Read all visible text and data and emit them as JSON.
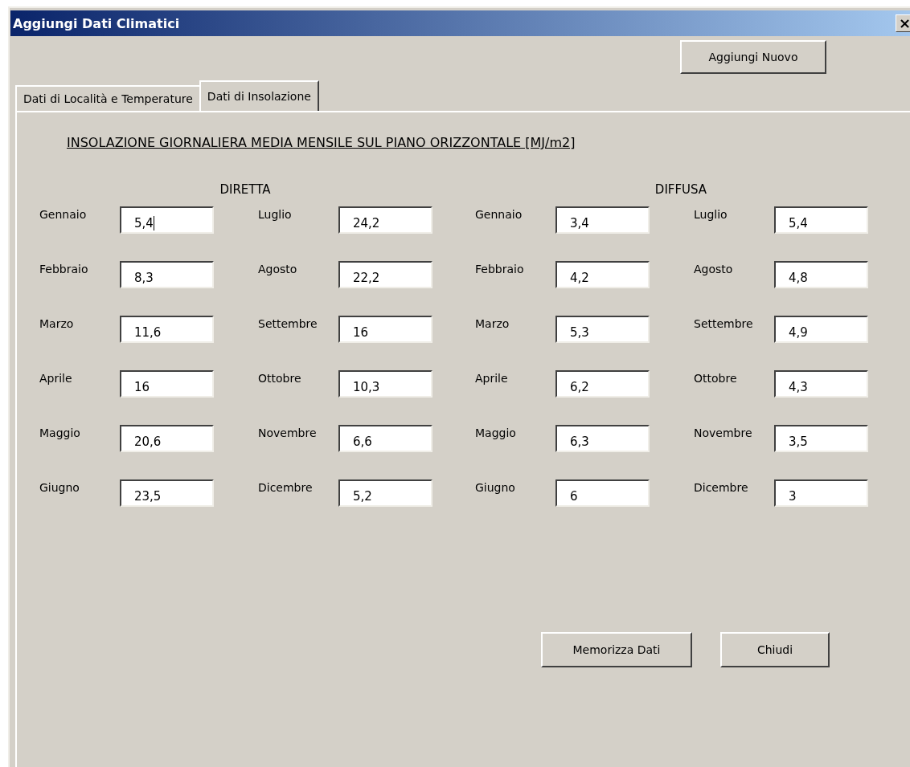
{
  "window": {
    "title": "Aggiungi Dati Climatici",
    "close": "×"
  },
  "top_button": "Aggiungi Nuovo",
  "tabs": [
    {
      "label": "Dati di Località e Temperature",
      "selected": false
    },
    {
      "label": "Dati di Insolazione",
      "selected": true
    }
  ],
  "heading": "INSOLAZIONE GIORNALIERA MEDIA MENSILE SUL PIANO ORIZZONTALE [MJ/m2]",
  "groups": [
    {
      "title": "DIRETTA",
      "months": [
        {
          "label": "Gennaio",
          "value": "5,4",
          "focused": true
        },
        {
          "label": "Febbraio",
          "value": "8,3",
          "focused": false
        },
        {
          "label": "Marzo",
          "value": "11,6",
          "focused": false
        },
        {
          "label": "Aprile",
          "value": "16",
          "focused": false
        },
        {
          "label": "Maggio",
          "value": "20,6",
          "focused": false
        },
        {
          "label": "Giugno",
          "value": "23,5",
          "focused": false
        },
        {
          "label": "Luglio",
          "value": "24,2",
          "focused": false
        },
        {
          "label": "Agosto",
          "value": "22,2",
          "focused": false
        },
        {
          "label": "Settembre",
          "value": "16",
          "focused": false
        },
        {
          "label": "Ottobre",
          "value": "10,3",
          "focused": false
        },
        {
          "label": "Novembre",
          "value": "6,6",
          "focused": false
        },
        {
          "label": "Dicembre",
          "value": "5,2",
          "focused": false
        }
      ]
    },
    {
      "title": "DIFFUSA",
      "months": [
        {
          "label": "Gennaio",
          "value": "3,4",
          "focused": false
        },
        {
          "label": "Febbraio",
          "value": "4,2",
          "focused": false
        },
        {
          "label": "Marzo",
          "value": "5,3",
          "focused": false
        },
        {
          "label": "Aprile",
          "value": "6,2",
          "focused": false
        },
        {
          "label": "Maggio",
          "value": "6,3",
          "focused": false
        },
        {
          "label": "Giugno",
          "value": "6",
          "focused": false
        },
        {
          "label": "Luglio",
          "value": "5,4",
          "focused": false
        },
        {
          "label": "Agosto",
          "value": "4,8",
          "focused": false
        },
        {
          "label": "Settembre",
          "value": "4,9",
          "focused": false
        },
        {
          "label": "Ottobre",
          "value": "4,3",
          "focused": false
        },
        {
          "label": "Novembre",
          "value": "3,5",
          "focused": false
        },
        {
          "label": "Dicembre",
          "value": "3",
          "focused": false
        }
      ]
    }
  ],
  "buttons": [
    "Memorizza Dati",
    "Chiudi"
  ]
}
